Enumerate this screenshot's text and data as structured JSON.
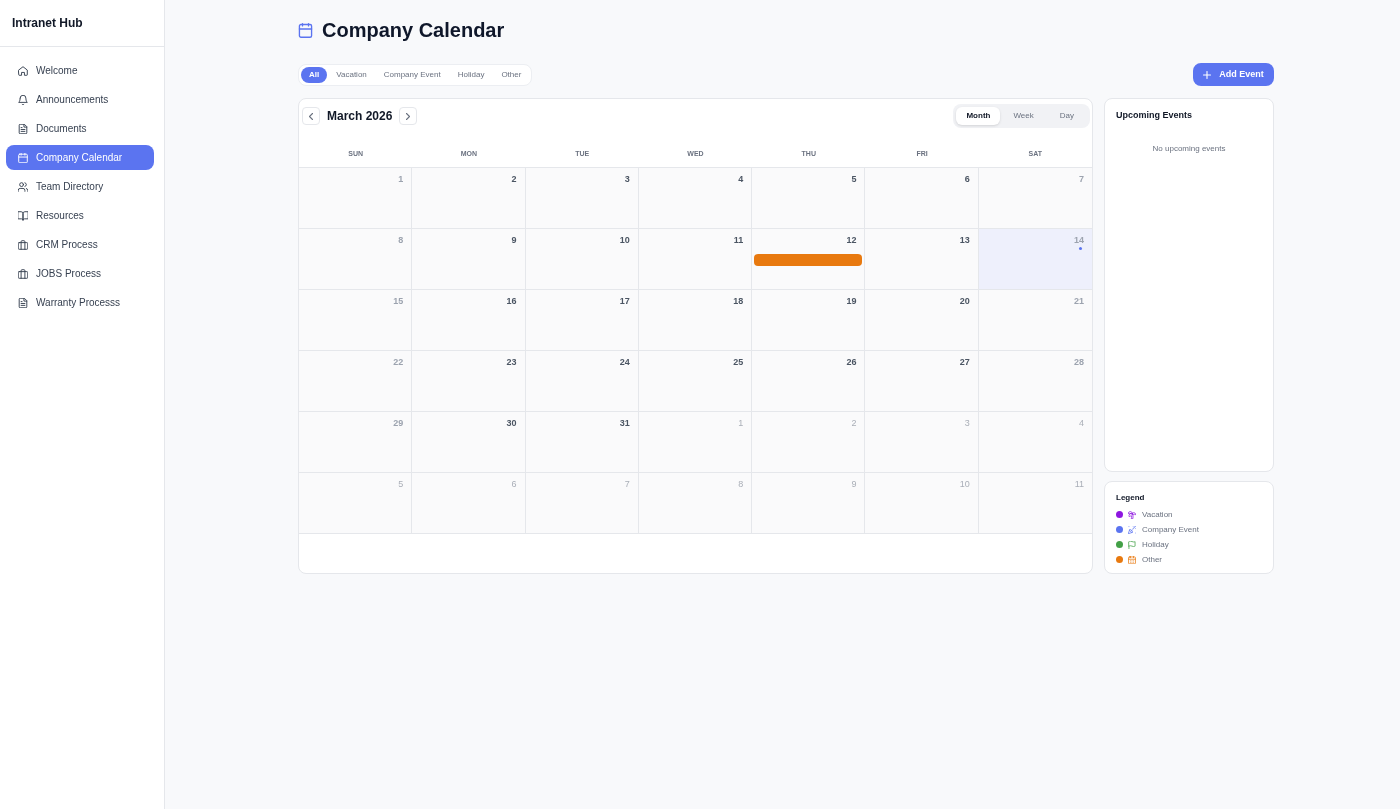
{
  "sidebar": {
    "title": "Intranet Hub",
    "items": [
      {
        "label": "Welcome",
        "selected": false
      },
      {
        "label": "Announcements",
        "selected": false
      },
      {
        "label": "Documents",
        "selected": false
      },
      {
        "label": "Company Calendar",
        "selected": true
      },
      {
        "label": "Team Directory",
        "selected": false
      },
      {
        "label": "Resources",
        "selected": false
      },
      {
        "label": "CRM Process",
        "selected": false
      },
      {
        "label": "JOBS Process",
        "selected": false
      },
      {
        "label": "Warranty Processs",
        "selected": false
      }
    ]
  },
  "header": {
    "title": "Company Calendar"
  },
  "filters": [
    {
      "label": "All",
      "selected": true
    },
    {
      "label": "Vacation",
      "selected": false
    },
    {
      "label": "Company Event",
      "selected": false
    },
    {
      "label": "Holiday",
      "selected": false
    },
    {
      "label": "Other",
      "selected": false
    }
  ],
  "add_button": {
    "label": "Add Event"
  },
  "calendar": {
    "month": "March 2026",
    "views": [
      {
        "label": "Month",
        "selected": true
      },
      {
        "label": "Week",
        "selected": false
      },
      {
        "label": "Day",
        "selected": false
      }
    ],
    "weekdays": [
      "SUN",
      "MON",
      "TUE",
      "WED",
      "THU",
      "FRI",
      "SAT"
    ],
    "weeks": [
      [
        {
          "day": "1",
          "other_month": false,
          "today": false
        },
        {
          "day": "2",
          "other_month": false,
          "today": false
        },
        {
          "day": "3",
          "other_month": false,
          "today": false
        },
        {
          "day": "4",
          "other_month": false,
          "today": false
        },
        {
          "day": "5",
          "other_month": false,
          "today": false
        },
        {
          "day": "6",
          "other_month": false,
          "today": false
        },
        {
          "day": "7",
          "other_month": false,
          "today": false
        }
      ],
      [
        {
          "day": "8",
          "other_month": false,
          "today": false
        },
        {
          "day": "9",
          "other_month": false,
          "today": false
        },
        {
          "day": "10",
          "other_month": false,
          "today": false
        },
        {
          "day": "11",
          "other_month": false,
          "today": false
        },
        {
          "day": "12",
          "other_month": false,
          "today": false,
          "events": [
            {
              "color": "#e8790f"
            }
          ]
        },
        {
          "day": "13",
          "other_month": false,
          "today": false
        },
        {
          "day": "14",
          "other_month": false,
          "today": true
        }
      ],
      [
        {
          "day": "15",
          "other_month": false,
          "today": false
        },
        {
          "day": "16",
          "other_month": false,
          "today": false
        },
        {
          "day": "17",
          "other_month": false,
          "today": false
        },
        {
          "day": "18",
          "other_month": false,
          "today": false
        },
        {
          "day": "19",
          "other_month": false,
          "today": false
        },
        {
          "day": "20",
          "other_month": false,
          "today": false
        },
        {
          "day": "21",
          "other_month": false,
          "today": false
        }
      ],
      [
        {
          "day": "22",
          "other_month": false,
          "today": false
        },
        {
          "day": "23",
          "other_month": false,
          "today": false
        },
        {
          "day": "24",
          "other_month": false,
          "today": false
        },
        {
          "day": "25",
          "other_month": false,
          "today": false
        },
        {
          "day": "26",
          "other_month": false,
          "today": false
        },
        {
          "day": "27",
          "other_month": false,
          "today": false
        },
        {
          "day": "28",
          "other_month": false,
          "today": false
        }
      ],
      [
        {
          "day": "29",
          "other_month": false,
          "today": false
        },
        {
          "day": "30",
          "other_month": false,
          "today": false
        },
        {
          "day": "31",
          "other_month": false,
          "today": false
        },
        {
          "day": "1",
          "other_month": true,
          "today": false
        },
        {
          "day": "2",
          "other_month": true,
          "today": false
        },
        {
          "day": "3",
          "other_month": true,
          "today": false
        },
        {
          "day": "4",
          "other_month": true,
          "today": false
        }
      ],
      [
        {
          "day": "5",
          "other_month": true,
          "today": false
        },
        {
          "day": "6",
          "other_month": true,
          "today": false
        },
        {
          "day": "7",
          "other_month": true,
          "today": false
        },
        {
          "day": "8",
          "other_month": true,
          "today": false
        },
        {
          "day": "9",
          "other_month": true,
          "today": false
        },
        {
          "day": "10",
          "other_month": true,
          "today": false
        },
        {
          "day": "11",
          "other_month": true,
          "today": false
        }
      ]
    ]
  },
  "upcoming": {
    "title": "Upcoming Events",
    "empty_message": "No upcoming events"
  },
  "legend": {
    "title": "Legend",
    "items": [
      {
        "label": "Vacation",
        "color": "#8e16e0"
      },
      {
        "label": "Company Event",
        "color": "#5b74f0"
      },
      {
        "label": "Holiday",
        "color": "#43a047"
      },
      {
        "label": "Other",
        "color": "#e8790f"
      }
    ]
  }
}
